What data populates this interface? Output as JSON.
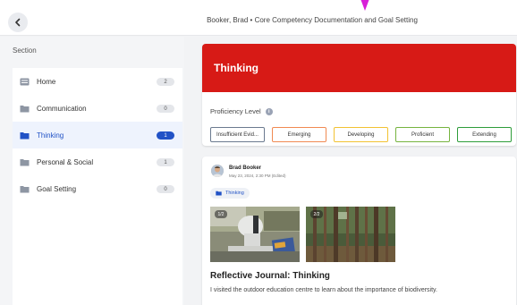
{
  "header": {
    "title": "Booker, Brad • Core Competency Documentation and Goal Setting"
  },
  "sidebar": {
    "section_label": "Section",
    "items": [
      {
        "label": "Home",
        "count": "2",
        "icon": "home-icon"
      },
      {
        "label": "Communication",
        "count": "0",
        "icon": "folder-icon"
      },
      {
        "label": "Thinking",
        "count": "1",
        "icon": "folder-icon",
        "active": true
      },
      {
        "label": "Personal & Social",
        "count": "1",
        "icon": "folder-icon"
      },
      {
        "label": "Goal Setting",
        "count": "0",
        "icon": "folder-icon"
      }
    ]
  },
  "competency": {
    "title": "Thinking",
    "proficiency_label": "Proficiency Level",
    "levels": [
      {
        "label": "Insufficient Evid...",
        "color": "#6b7a8f"
      },
      {
        "label": "Emerging",
        "color": "#f08a52"
      },
      {
        "label": "Developing",
        "color": "#f2c232"
      },
      {
        "label": "Proficient",
        "color": "#76b43f"
      },
      {
        "label": "Extending",
        "color": "#2e9d3a"
      }
    ]
  },
  "post": {
    "author": "Brad Booker",
    "date": "May 23, 2024, 2:30 PM (Edited)",
    "tag": "Thinking",
    "images": [
      {
        "badge": "1/2"
      },
      {
        "badge": "2/2"
      }
    ],
    "title": "Reflective Journal: Thinking",
    "body": "I visited the outdoor education centre to learn about the importance of biodiversity."
  },
  "colors": {
    "accent": "#2152c6",
    "header_red": "#d71a16",
    "pointer": "#d81fd8"
  }
}
